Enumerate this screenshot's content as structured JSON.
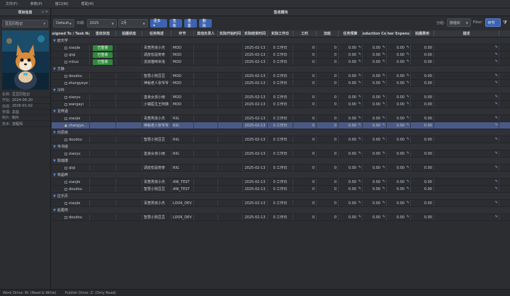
{
  "menu": [
    "文件(F)",
    "参数(P)",
    "窗口(W)",
    "帮助(H)"
  ],
  "left_panel": {
    "title": "项目信息",
    "project": "豆豆历险记",
    "info": [
      {
        "k": "名称:",
        "v": "豆豆历险记"
      },
      {
        "k": "开始:",
        "v": "2024-06-20"
      },
      {
        "k": "完成:",
        "v": "2026-01-02"
      },
      {
        "k": "管理:",
        "v": "总监"
      },
      {
        "k": "制片:",
        "v": "制片"
      },
      {
        "k": "技术:",
        "v": "流程师"
      }
    ]
  },
  "content": {
    "title": "签收模块",
    "toolbar": {
      "default": "Default",
      "date_label": "日期:",
      "year": "2025",
      "month": "2月",
      "more": "更多 ▸",
      "sign": "签收",
      "retire": "重置",
      "delete": "删除",
      "group_label": "分组:",
      "group_value": "按组织",
      "filter_label": "Filter:",
      "filter_value": "环节"
    },
    "columns": [
      "ssigned To / Task Na",
      "签收状态",
      "拍摄状态",
      "任务简述",
      "环节",
      "其他负责人",
      "实际开始时间",
      "实际结束时间",
      "实际工作日",
      "工时",
      "加班",
      "任务预算",
      "oduction Co",
      "her Expens",
      "拍摄费用",
      "描述"
    ],
    "groups": [
      {
        "name": "欧天学",
        "rows": [
          {
            "name": "xiaojie",
            "status": "已签收",
            "task": "青葱男孩小杰",
            "step": "MOD",
            "end": "2025-02-13",
            "days": "0 工作日"
          },
          {
            "name": "qiqi",
            "status": "已签收",
            "task": "调皮松鼠奇奇",
            "step": "MOD",
            "end": "2025-02-13",
            "days": "0 工作日"
          },
          {
            "name": "miluo",
            "status": "已签收",
            "task": "流浪猫咪米洛",
            "step": "MOD",
            "end": "2025-02-13",
            "days": "0 工作日"
          }
        ]
      },
      {
        "name": "方静",
        "rows": [
          {
            "name": "doudou",
            "status": "",
            "task": "智慧小狗豆豆",
            "step": "MOD",
            "end": "2025-02-13",
            "days": "0 工作日"
          },
          {
            "name": "zhangyeye",
            "status": "",
            "task": "神秘老人张爷爷",
            "step": "MOD",
            "end": "2025-02-13",
            "days": "0 工作日"
          }
        ]
      },
      {
        "name": "冷吟",
        "rows": [
          {
            "name": "xiaoyu",
            "status": "",
            "task": "善良女孩小雨",
            "step": "MOD",
            "end": "2025-02-13",
            "days": "0 工作日"
          },
          {
            "name": "wangayi",
            "status": "",
            "task": "小镇医生王阿姨",
            "step": "MOD",
            "end": "2025-02-13",
            "days": "0 工作日"
          }
        ]
      },
      {
        "name": "龙梓涵",
        "rows": [
          {
            "name": "xiaojie",
            "status": "",
            "task": "青葱男孩小杰",
            "step": "RIG",
            "end": "2025-02-13",
            "days": "0 工作日"
          },
          {
            "name": "zhangye…",
            "status": "",
            "task": "神秘老人张爷爷",
            "step": "RIG",
            "end": "2025-02-13",
            "days": "0 工作日",
            "selected": true
          }
        ]
      },
      {
        "name": "向思雨",
        "rows": [
          {
            "name": "doudou",
            "status": "",
            "task": "智慧小狗豆豆",
            "step": "RIG",
            "end": "2025-02-13",
            "days": "0 工作日"
          }
        ]
      },
      {
        "name": "韦书瑶",
        "rows": [
          {
            "name": "xiaoyu",
            "status": "",
            "task": "善良女孩小雨",
            "step": "RIG",
            "end": "2025-02-13",
            "days": "0 工作日"
          }
        ]
      },
      {
        "name": "陈瑞博",
        "rows": [
          {
            "name": "qiqi",
            "status": "",
            "task": "调皮松鼠奇奇",
            "step": "RIG",
            "end": "2025-02-13",
            "days": "0 工作日"
          }
        ]
      },
      {
        "name": "林晶晔",
        "rows": [
          {
            "name": "xiaojie",
            "status": "",
            "task": "青葱男孩小杰",
            "step": "ANI_TEST",
            "end": "2025-02-13",
            "days": "0 工作日"
          },
          {
            "name": "doudou",
            "status": "",
            "task": "智慧小狗豆豆",
            "step": "ANI_TEST",
            "end": "2025-02-13",
            "days": "0 工作日"
          }
        ]
      },
      {
        "name": "庄乐丹",
        "rows": [
          {
            "name": "xiaojie",
            "status": "",
            "task": "青葱男孩小杰",
            "step": "LOOK_DEV",
            "end": "2025-02-13",
            "days": "0 工作日"
          }
        ]
      },
      {
        "name": "赵霞珂",
        "rows": [
          {
            "name": "doudou",
            "status": "",
            "task": "智慧小狗豆豆",
            "step": "LOOK_DEV",
            "end": "2025-02-13",
            "days": "0 工作日"
          }
        ]
      }
    ],
    "zero": "0",
    "money": "0.00"
  },
  "status": {
    "work": "Work Drive: W: (Read & Write)",
    "publish": "Publish Drive: Z: (Only Read)"
  },
  "colors": {
    "accent": "#3d63b0",
    "signed": "#2f8a3c",
    "selected": "#4a5a86"
  }
}
